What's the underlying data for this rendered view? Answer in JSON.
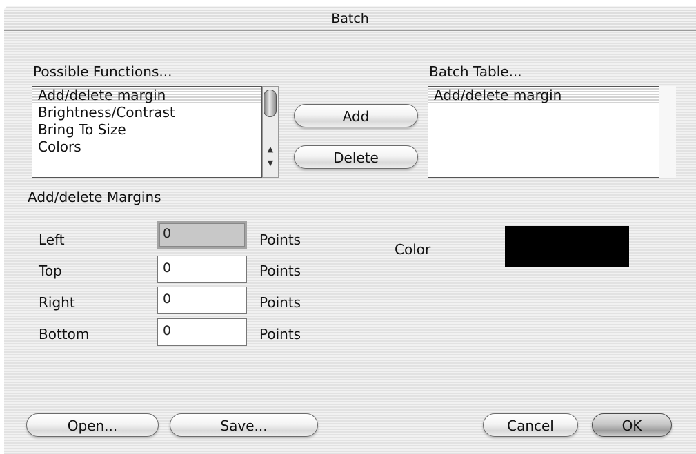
{
  "window": {
    "title": "Batch"
  },
  "possible_functions": {
    "label": "Possible Functions...",
    "items": [
      "Add/delete margin",
      "Brightness/Contrast",
      "Bring To Size",
      "Colors"
    ],
    "selected_index": 0
  },
  "batch_table": {
    "label": "Batch Table...",
    "items": [
      "Add/delete margin"
    ]
  },
  "buttons": {
    "add": "Add",
    "delete": "Delete",
    "open": "Open...",
    "save": "Save...",
    "cancel": "Cancel",
    "ok": "OK"
  },
  "margins": {
    "section_label": "Add/delete Margins",
    "unit": "Points",
    "left": {
      "label": "Left",
      "value": "0"
    },
    "top": {
      "label": "Top",
      "value": "0"
    },
    "right": {
      "label": "Right",
      "value": "0"
    },
    "bottom": {
      "label": "Bottom",
      "value": "0"
    }
  },
  "color": {
    "label": "Color",
    "value": "#000000"
  },
  "icons": {
    "scroll_up": "up-arrow-icon",
    "scroll_down": "down-arrow-icon"
  }
}
